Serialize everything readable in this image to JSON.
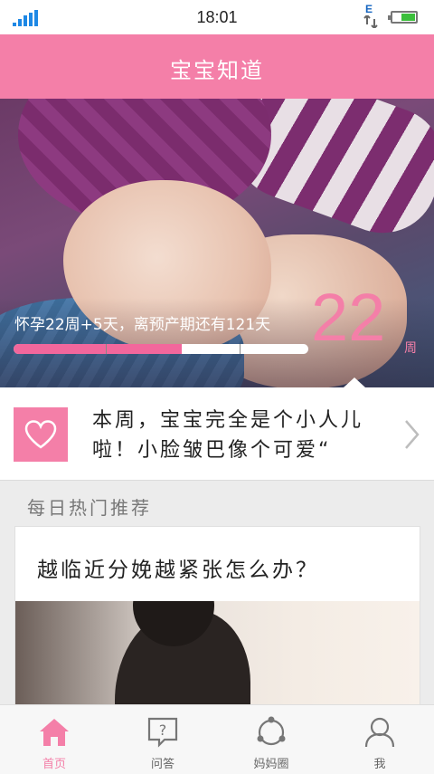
{
  "status_bar": {
    "time": "18:01",
    "network_label": "E",
    "signal_icon": "signal-icon",
    "battery_icon": "battery-icon"
  },
  "header": {
    "title": "宝宝知道"
  },
  "hero": {
    "progress_text": "怀孕22周+5天，离预产期还有121天",
    "progress_fraction": 0.57,
    "current_week": "22",
    "week_unit": "周"
  },
  "weekly_tip": {
    "text": "本周，宝宝完全是个小人儿啦！小脸皱巴像个可爱“",
    "icon": "heart-icon"
  },
  "daily": {
    "section_title": "每日热门推荐",
    "article_title": "越临近分娩越紧张怎么办？"
  },
  "tabbar": {
    "tabs": [
      {
        "label": "首页",
        "icon": "home-icon",
        "active": true
      },
      {
        "label": "问答",
        "icon": "question-icon",
        "active": false
      },
      {
        "label": "妈妈圈",
        "icon": "circle-icon",
        "active": false
      },
      {
        "label": "我",
        "icon": "user-icon",
        "active": false
      }
    ]
  },
  "colors": {
    "accent": "#f47fa8",
    "progress": "#f2679c"
  }
}
